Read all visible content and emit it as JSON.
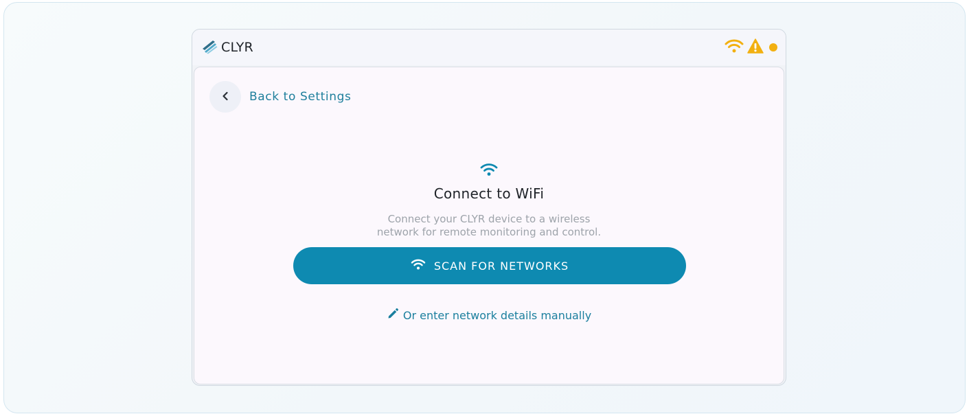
{
  "app": {
    "brand_name": "CLYR",
    "brand_icon": "clyr-logo-icon"
  },
  "status_bar": {
    "icons": [
      "wifi-icon",
      "warning-icon",
      "status-dot"
    ],
    "accent_color": "#f2b011"
  },
  "navigation": {
    "back_label": "Back to Settings",
    "back_icon": "chevron-left-icon"
  },
  "wifi_setup": {
    "hero_icon": "wifi-icon",
    "title": "Connect to WiFi",
    "description_line1": "Connect your CLYR device to a wireless",
    "description_line2": "network for remote monitoring and control.",
    "scan_button_label": "SCAN FOR NETWORKS",
    "scan_button_icon": "wifi-icon",
    "manual_link_label": "Or enter network details manually",
    "manual_link_icon": "pencil-icon"
  },
  "colors": {
    "primary": "#0e8ab1",
    "link": "#1b7f9e",
    "warning": "#f2b011"
  }
}
